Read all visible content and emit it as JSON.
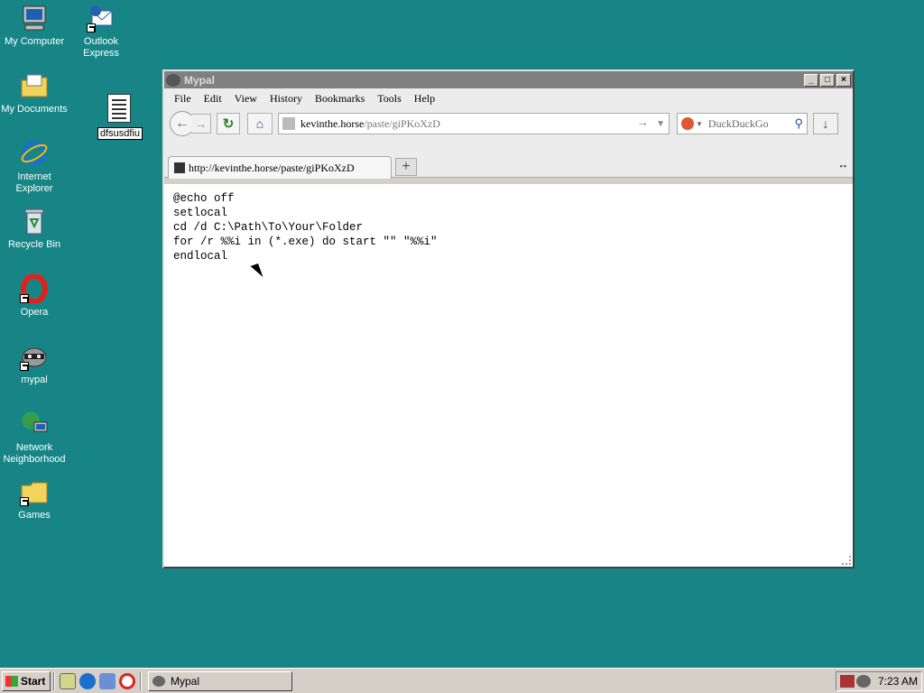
{
  "desktop": {
    "icons": [
      {
        "label": "My Computer"
      },
      {
        "label": "Outlook Express"
      },
      {
        "label": "My Documents"
      },
      {
        "label": "Internet Explorer"
      },
      {
        "label": "Recycle Bin"
      },
      {
        "label": "Opera"
      },
      {
        "label": "mypal"
      },
      {
        "label": "Network Neighborhood"
      },
      {
        "label": "Games"
      }
    ],
    "file": {
      "rename_value": "dfsusdfiu"
    }
  },
  "window": {
    "title": "Mypal",
    "controls": {
      "minimize": "_",
      "maximize": "□",
      "close": "×"
    },
    "menu": [
      "File",
      "Edit",
      "View",
      "History",
      "Bookmarks",
      "Tools",
      "Help"
    ],
    "url": {
      "host": "kevinthe.horse",
      "path": "/paste/giPKoXzD"
    },
    "search": {
      "placeholder": "DuckDuckGo"
    },
    "tab": {
      "title": "http://kevinthe.horse/paste/giPKoXzD"
    },
    "content_lines": [
      "@echo off",
      "setlocal",
      "cd /d C:\\Path\\To\\Your\\Folder",
      "for /r %%i in (*.exe) do start \"\" \"%%i\"",
      "endlocal"
    ]
  },
  "taskbar": {
    "start_label": "Start",
    "task_label": "Mypal",
    "clock": "7:23 AM"
  }
}
